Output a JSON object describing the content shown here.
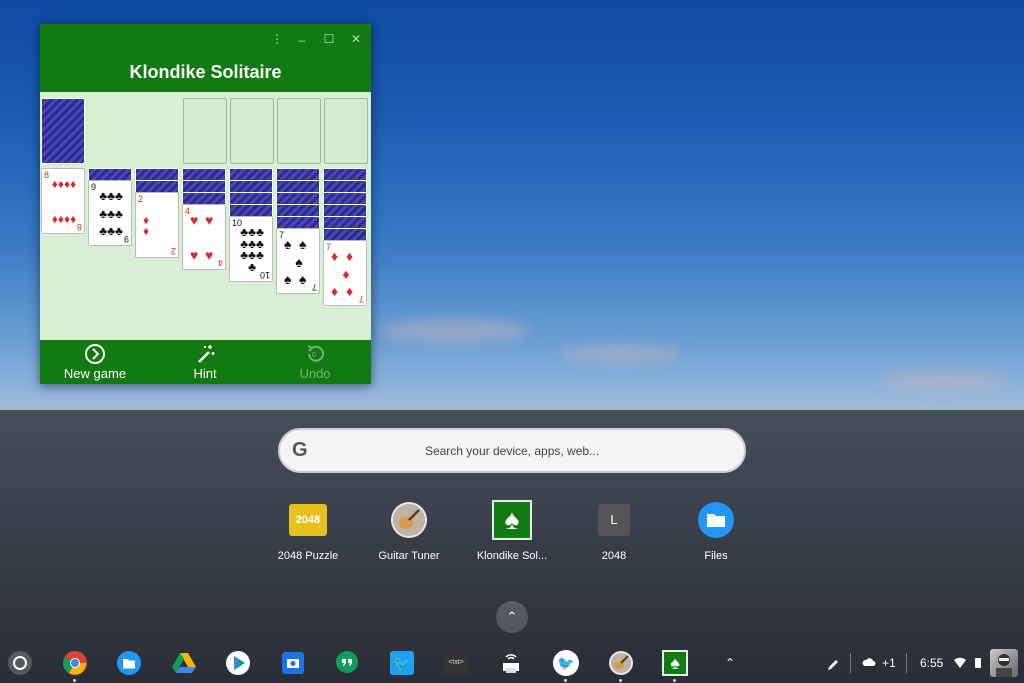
{
  "window": {
    "title": "Klondike Solitaire",
    "controls": {
      "menu": "⋮",
      "minimize": "_",
      "maximize": "☐",
      "close": "✕"
    },
    "bottom_bar": {
      "new_game": "New game",
      "hint": "Hint",
      "undo": "Undo",
      "undo_count": "0"
    }
  },
  "tableau": {
    "col1": {
      "rank": "8",
      "suit": "♦"
    },
    "col2": {
      "rank": "9",
      "suit": "♣"
    },
    "col3": {
      "rank": "2",
      "suit": "♦"
    },
    "col4": {
      "rank": "4",
      "suit": "♥"
    },
    "col5": {
      "rank": "10",
      "suit": "♣"
    },
    "col6": {
      "rank": "7",
      "suit": "♠"
    },
    "col7": {
      "rank": "7",
      "suit": "♦"
    }
  },
  "launcher": {
    "search_placeholder": "Search your device, apps, web...",
    "google_glyph": "G",
    "apps": [
      {
        "name": "2048 Puzzle",
        "icon": "2048"
      },
      {
        "name": "Guitar Tuner",
        "icon": "guitar-icon"
      },
      {
        "name": "Klondike Sol...",
        "icon": "spade-icon"
      },
      {
        "name": "2048",
        "icon": "L"
      },
      {
        "name": "Files",
        "icon": "folder-icon"
      }
    ],
    "expand": "⌃"
  },
  "shelf": {
    "txt_app": "<txt>",
    "up_arrow": "⌃"
  },
  "tray": {
    "notification_count": "+1",
    "time": "6:55"
  },
  "colors": {
    "window_green": "#117a11",
    "felt": "#d7f0d3",
    "card_back": "#2d2b92",
    "red_suit": "#d2302a"
  }
}
